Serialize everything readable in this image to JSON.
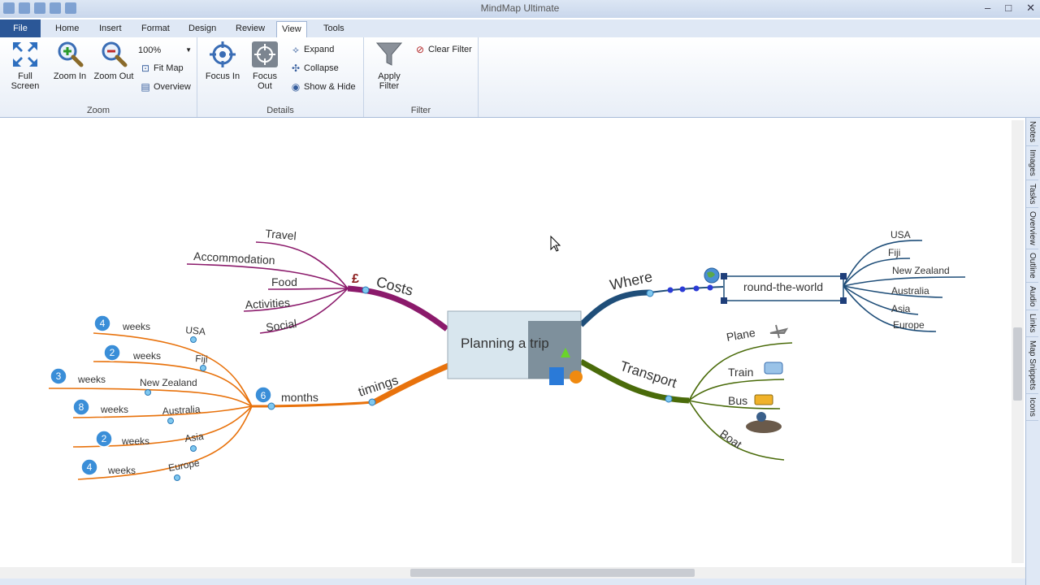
{
  "window": {
    "title": "MindMap Ultimate",
    "controls": [
      "–",
      "□",
      "✕"
    ]
  },
  "ribbon_tabs": [
    "File",
    "Home",
    "Insert",
    "Format",
    "Design",
    "Review",
    "View",
    "Tools"
  ],
  "ribbon": {
    "zoom": {
      "label": "Zoom",
      "full_screen": "Full\nScreen",
      "zoom_in": "Zoom In",
      "zoom_out": "Zoom Out",
      "zoom_level": "100%",
      "fit_map": "Fit Map",
      "overview": "Overview"
    },
    "details": {
      "label": "Details",
      "focus_in": "Focus In",
      "focus_out": "Focus\nOut",
      "expand": "Expand",
      "collapse": "Collapse",
      "show_hide": "Show & Hide"
    },
    "filter": {
      "label": "Filter",
      "apply_filter": "Apply\nFilter",
      "clear_filter": "Clear Filter"
    }
  },
  "right_pane": [
    "Notes",
    "Images",
    "Tasks",
    "Overview",
    "Outline",
    "Audio",
    "Links",
    "Map Snippets",
    "Icons"
  ],
  "mindmap": {
    "center": "Planning a trip",
    "costs": {
      "label": "Costs",
      "icon": "£",
      "items": [
        "Travel",
        "Accommodation",
        "Food",
        "Activities",
        "Social"
      ]
    },
    "timings": {
      "label": "timings",
      "months": {
        "count": "6",
        "label": "months"
      },
      "items": [
        {
          "count": "4",
          "unit": "weeks",
          "place": "USA"
        },
        {
          "count": "2",
          "unit": "weeks",
          "place": "Fiji"
        },
        {
          "count": "3",
          "unit": "weeks",
          "place": "New Zealand"
        },
        {
          "count": "8",
          "unit": "weeks",
          "place": "Australia"
        },
        {
          "count": "2",
          "unit": "weeks",
          "place": "Asia"
        },
        {
          "count": "4",
          "unit": "weeks",
          "place": "Europe"
        }
      ]
    },
    "where": {
      "label": "Where",
      "node": "round-the-world",
      "items": [
        "USA",
        "Fiji",
        "New Zealand",
        "Australia",
        "Asia",
        "Europe"
      ]
    },
    "transport": {
      "label": "Transport",
      "items": [
        "Plane",
        "Train",
        "Bus",
        "Boat"
      ]
    }
  },
  "colors": {
    "costs": "#8b1a6b",
    "timings": "#e8720c",
    "where": "#1f4e79",
    "transport": "#4a6b0a",
    "file_tab": "#2b5797"
  }
}
